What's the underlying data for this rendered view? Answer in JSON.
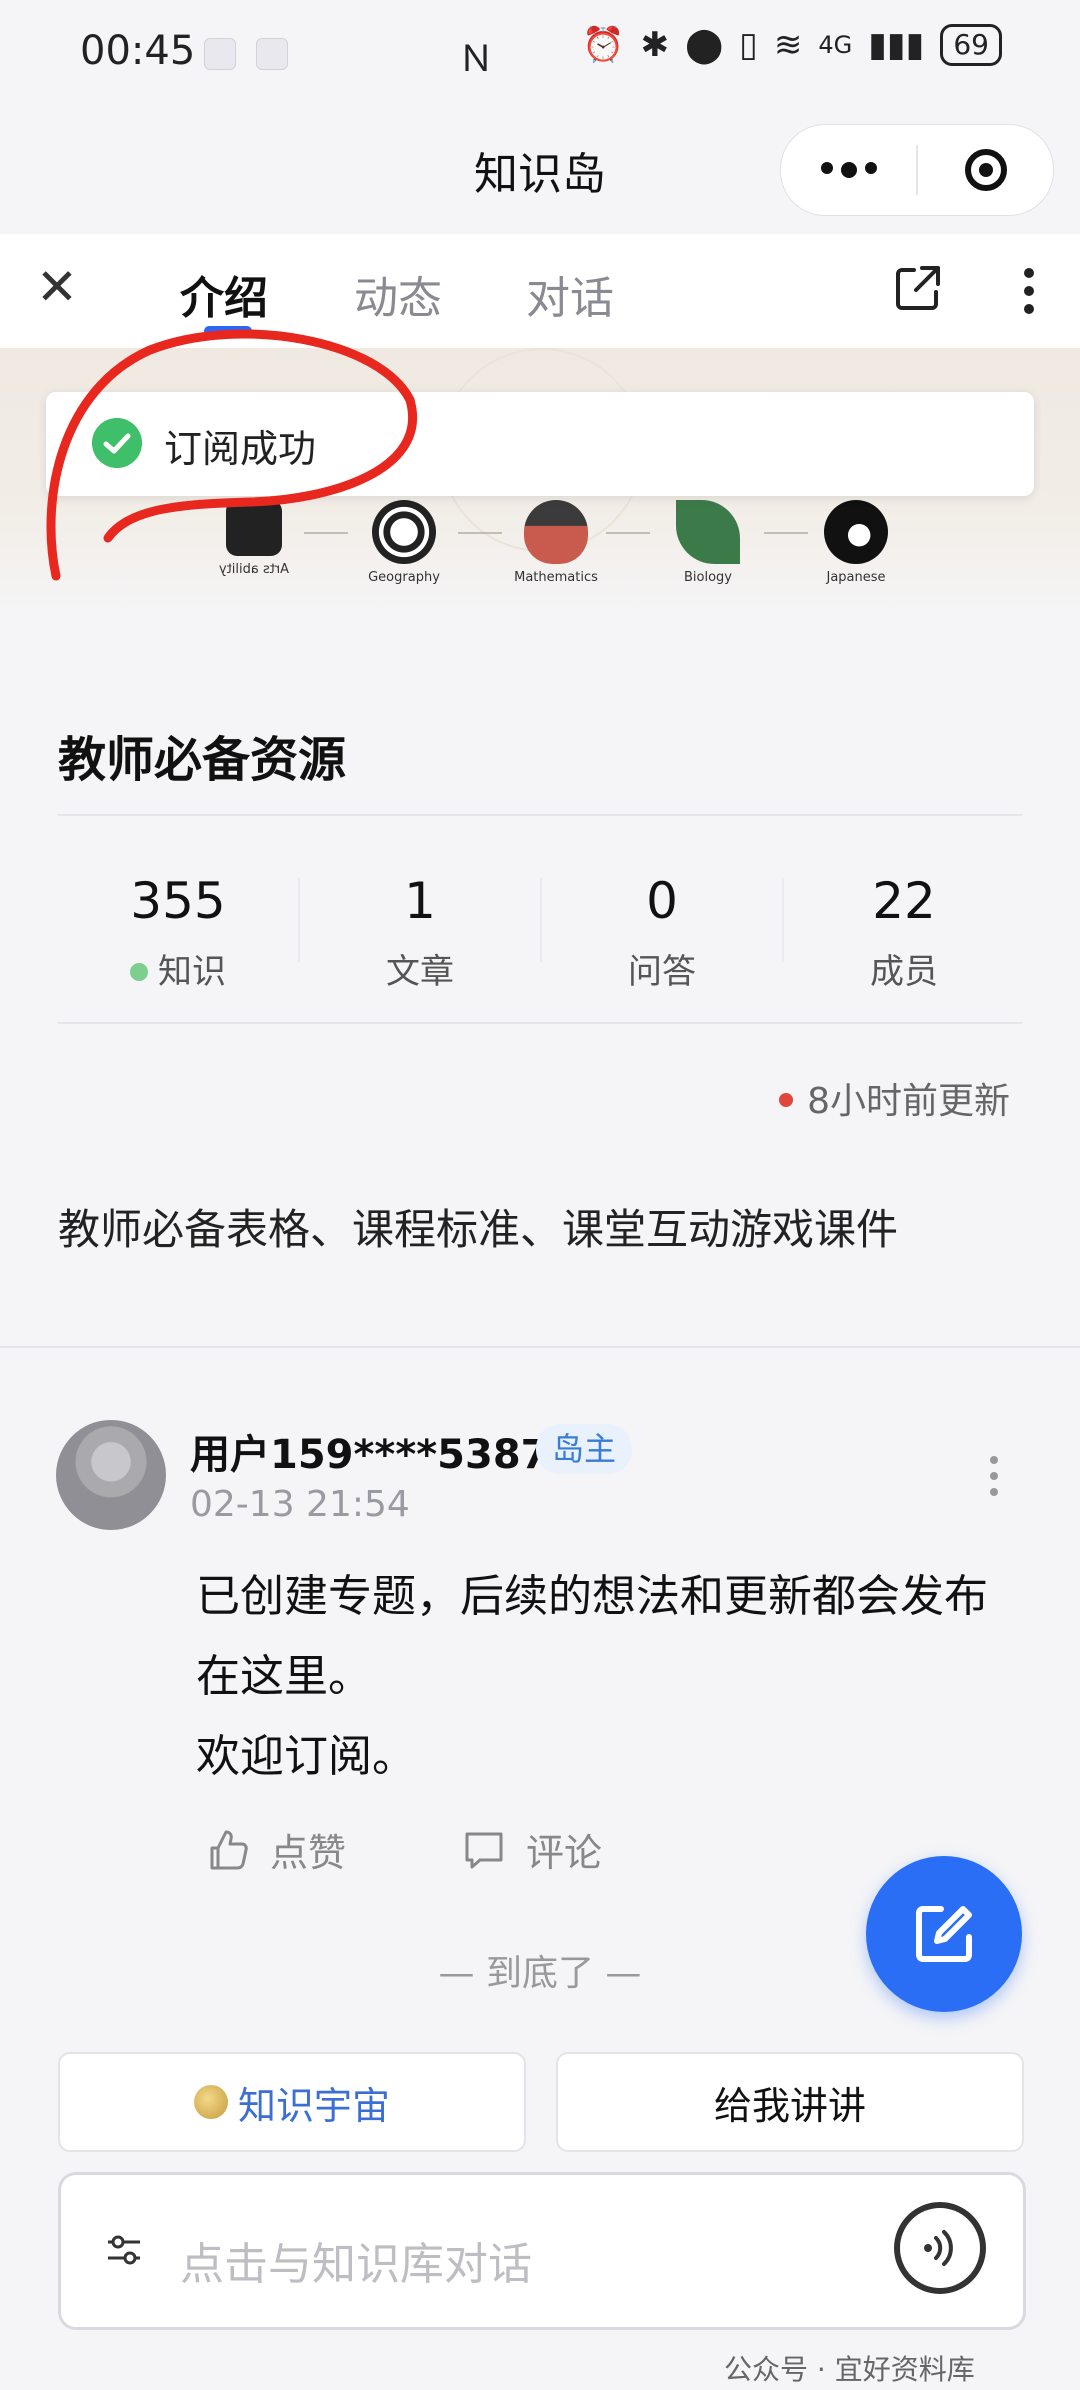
{
  "status_bar": {
    "time": "00:45",
    "battery": "69",
    "network": "4G"
  },
  "mini_program": {
    "title": "知识岛"
  },
  "tabs": [
    {
      "label": "介绍",
      "active": true
    },
    {
      "label": "动态",
      "active": false
    },
    {
      "label": "对话",
      "active": false
    }
  ],
  "banner": {
    "subjects": [
      "Geography",
      "Mathematics",
      "Biology",
      "Japanese"
    ],
    "first_subject_mirrored": "Arts ability"
  },
  "toast": {
    "text": "订阅成功"
  },
  "island": {
    "title": "教师必备资源",
    "stats": [
      {
        "value": "355",
        "label": "知识"
      },
      {
        "value": "1",
        "label": "文章"
      },
      {
        "value": "0",
        "label": "问答"
      },
      {
        "value": "22",
        "label": "成员"
      }
    ],
    "update_text": "8小时前更新",
    "description": "教师必备表格、课程标准、课堂互动游戏课件"
  },
  "post": {
    "username": "用户159****5387",
    "badge": "岛主",
    "time": "02-13 21:54",
    "lines": [
      "已创建专题，后续的想法和更新都会发布",
      "在这里。",
      "欢迎订阅。"
    ],
    "like_label": "点赞",
    "comment_label": "评论"
  },
  "end_text": "— 到底了 —",
  "bottom": {
    "universe_label": "知识宇宙",
    "explain_label": "给我讲讲",
    "chat_placeholder": "点击与知识库对话"
  },
  "watermark": "公众号 · 宜好资料库",
  "colors": {
    "accent": "#2a6ef5",
    "success": "#3fbf6a",
    "update_dot": "#e0463c",
    "badge_text": "#3a7bd5"
  }
}
